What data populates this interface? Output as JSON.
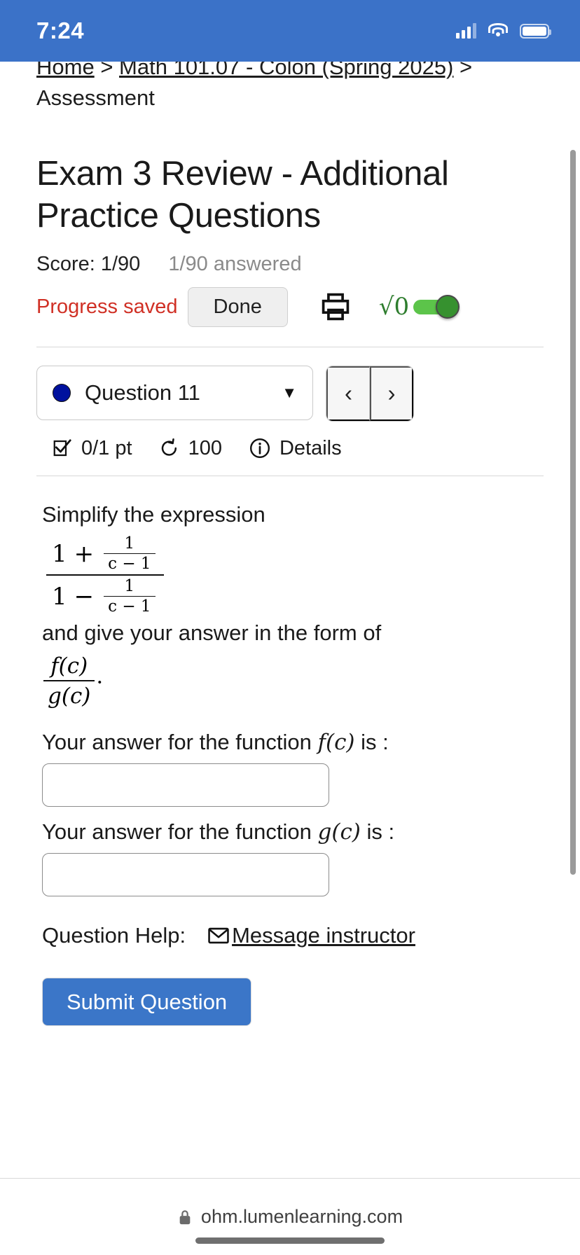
{
  "status_bar": {
    "time": "7:24",
    "icons": [
      "cellular-signal-icon",
      "wifi-icon",
      "battery-icon"
    ]
  },
  "breadcrumb": {
    "items": [
      {
        "label": "Home"
      },
      {
        "label": "Math 101.07 - Colon (Spring 2025)"
      },
      {
        "label": "Assessment"
      }
    ],
    "separator": ">"
  },
  "assessment": {
    "title": "Exam 3 Review - Additional Practice Questions",
    "score_label": "Score: 1/90",
    "answered_label": "1/90 answered",
    "progress_saved": "Progress saved",
    "done_label": "Done",
    "print_icon": "printer-icon",
    "math_toggle": {
      "glyph": "√0",
      "state": "on",
      "color": "#36912f"
    }
  },
  "question_nav": {
    "current_question": "Question 11",
    "status_dot_color": "#00119e",
    "caret": "▼",
    "prev_label": "‹",
    "next_label": "›"
  },
  "question_meta": {
    "points": "0/1 pt",
    "attempts": "100",
    "details_label": "Details",
    "check_icon": "checkbox-check-icon",
    "retry_icon": "retry-arrow-icon",
    "info_icon": "info-circle-icon"
  },
  "question": {
    "prompt_line1": "Simplify the expression",
    "expression": {
      "numerator": {
        "whole": "1",
        "op": "+",
        "frac_num": "1",
        "frac_den": "c − 1"
      },
      "denominator": {
        "whole": "1",
        "op": "−",
        "frac_num": "1",
        "frac_den": "c − 1"
      }
    },
    "prompt_line2": "and give your answer in the form of",
    "form_fraction": {
      "numerator": "f(c)",
      "denominator": "g(c)",
      "trailing": "."
    },
    "answer_f": {
      "label_prefix": "Your answer for the function",
      "label_math": "f(c)",
      "label_suffix": "is :",
      "value": "",
      "placeholder": ""
    },
    "answer_g": {
      "label_prefix": "Your answer for the function",
      "label_math": "g(c)",
      "label_suffix": "is :",
      "value": "",
      "placeholder": ""
    }
  },
  "help": {
    "label": "Question Help:",
    "mail_icon": "envelope-icon",
    "message_link": "Message instructor"
  },
  "actions": {
    "submit_label": "Submit Question",
    "submit_color": "#3b76c8"
  },
  "browser_bar": {
    "lock_icon": "lock-icon",
    "url": "ohm.lumenlearning.com"
  }
}
